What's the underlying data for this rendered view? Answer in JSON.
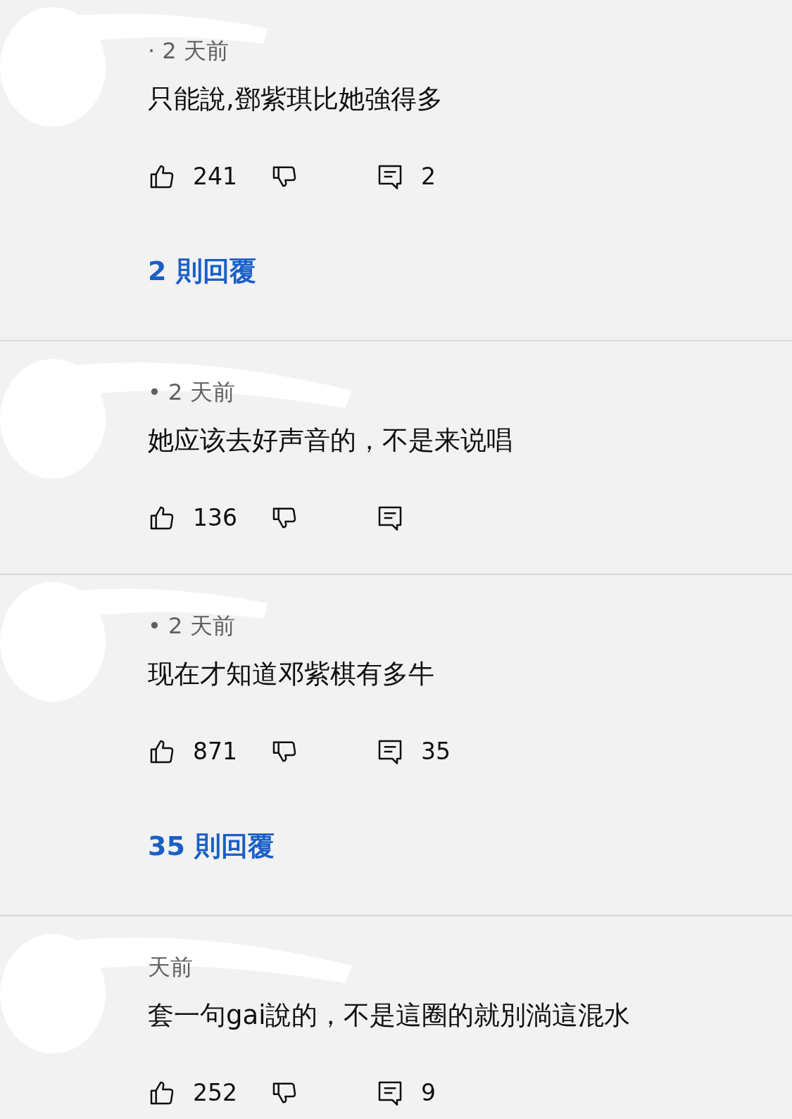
{
  "comments": [
    {
      "meta": "· 2 天前",
      "text": "只能說,鄧紫琪比她強得多",
      "likes": "241",
      "reply_count": "2",
      "replies_link": "2 則回覆"
    },
    {
      "meta": "• 2 天前",
      "text": "她应该去好声音的，不是来说唱",
      "likes": "136"
    },
    {
      "meta": "• 2 天前",
      "text": "现在才知道邓紫棋有多牛",
      "likes": "871",
      "reply_count": "35",
      "replies_link": "35 則回覆"
    },
    {
      "meta": "天前",
      "text": "套一句gai說的，不是這圈的就別淌這混水",
      "likes": "252",
      "reply_count": "9"
    }
  ]
}
